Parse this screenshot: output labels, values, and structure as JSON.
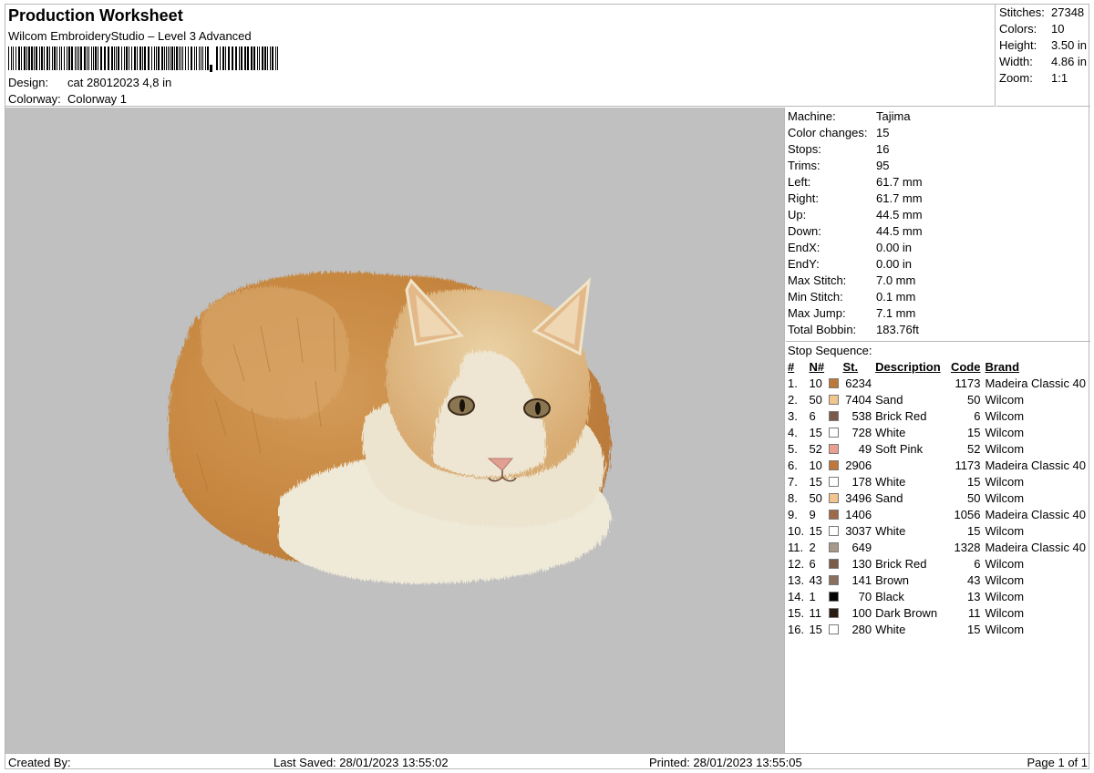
{
  "header": {
    "title": "Production Worksheet",
    "software": "Wilcom EmbroideryStudio – Level 3 Advanced",
    "design_label": "Design:",
    "design_value": "cat 28012023 4,8 in",
    "colorway_label": "Colorway:",
    "colorway_value": "Colorway 1"
  },
  "stats": [
    {
      "label": "Stitches:",
      "value": "27348"
    },
    {
      "label": "Colors:",
      "value": "10"
    },
    {
      "label": "Height:",
      "value": "3.50 in"
    },
    {
      "label": "Width:",
      "value": "4.86 in"
    },
    {
      "label": "Zoom:",
      "value": "1:1"
    }
  ],
  "machine_info": [
    {
      "label": "Machine:",
      "value": "Tajima"
    },
    {
      "label": "Color changes:",
      "value": "15"
    },
    {
      "label": "Stops:",
      "value": "16"
    },
    {
      "label": "Trims:",
      "value": "95"
    },
    {
      "label": "Left:",
      "value": "61.7 mm"
    },
    {
      "label": "Right:",
      "value": "61.7 mm"
    },
    {
      "label": "Up:",
      "value": "44.5 mm"
    },
    {
      "label": "Down:",
      "value": "44.5 mm"
    },
    {
      "label": "EndX:",
      "value": "0.00 in"
    },
    {
      "label": "EndY:",
      "value": "0.00 in"
    },
    {
      "label": "Max Stitch:",
      "value": "7.0 mm"
    },
    {
      "label": "Min Stitch:",
      "value": "0.1 mm"
    },
    {
      "label": "Max Jump:",
      "value": "7.1 mm"
    },
    {
      "label": "Total Bobbin:",
      "value": "183.76ft"
    }
  ],
  "stop_sequence": {
    "title": "Stop Sequence:",
    "columns": {
      "num": "#",
      "n": "N#",
      "st": "St.",
      "desc": "Description",
      "code": "Code",
      "brand": "Brand"
    },
    "rows": [
      {
        "num": "1.",
        "n": "10",
        "color": "#c0783a",
        "st": "6234",
        "desc": "",
        "code": "1173",
        "brand": "Madeira Classic 40"
      },
      {
        "num": "2.",
        "n": "50",
        "color": "#f2c48e",
        "st": "7404",
        "desc": "Sand",
        "code": "50",
        "brand": "Wilcom"
      },
      {
        "num": "3.",
        "n": "6",
        "color": "#7a5a48",
        "st": "538",
        "desc": "Brick Red",
        "code": "6",
        "brand": "Wilcom"
      },
      {
        "num": "4.",
        "n": "15",
        "color": "#ffffff",
        "st": "728",
        "desc": "White",
        "code": "15",
        "brand": "Wilcom"
      },
      {
        "num": "5.",
        "n": "52",
        "color": "#e8a090",
        "st": "49",
        "desc": "Soft Pink",
        "code": "52",
        "brand": "Wilcom"
      },
      {
        "num": "6.",
        "n": "10",
        "color": "#c0783a",
        "st": "2906",
        "desc": "",
        "code": "1173",
        "brand": "Madeira Classic 40"
      },
      {
        "num": "7.",
        "n": "15",
        "color": "#ffffff",
        "st": "178",
        "desc": "White",
        "code": "15",
        "brand": "Wilcom"
      },
      {
        "num": "8.",
        "n": "50",
        "color": "#f2c48e",
        "st": "3496",
        "desc": "Sand",
        "code": "50",
        "brand": "Wilcom"
      },
      {
        "num": "9.",
        "n": "9",
        "color": "#a06a48",
        "st": "1406",
        "desc": "",
        "code": "1056",
        "brand": "Madeira Classic 40"
      },
      {
        "num": "10.",
        "n": "15",
        "color": "#ffffff",
        "st": "3037",
        "desc": "White",
        "code": "15",
        "brand": "Wilcom"
      },
      {
        "num": "11.",
        "n": "2",
        "color": "#a89888",
        "st": "649",
        "desc": "",
        "code": "1328",
        "brand": "Madeira Classic 40"
      },
      {
        "num": "12.",
        "n": "6",
        "color": "#7a5a48",
        "st": "130",
        "desc": "Brick Red",
        "code": "6",
        "brand": "Wilcom"
      },
      {
        "num": "13.",
        "n": "43",
        "color": "#8a7060",
        "st": "141",
        "desc": "Brown",
        "code": "43",
        "brand": "Wilcom"
      },
      {
        "num": "14.",
        "n": "1",
        "color": "#000000",
        "st": "70",
        "desc": "Black",
        "code": "13",
        "brand": "Wilcom"
      },
      {
        "num": "15.",
        "n": "11",
        "color": "#2a1a10",
        "st": "100",
        "desc": "Dark Brown",
        "code": "11",
        "brand": "Wilcom"
      },
      {
        "num": "16.",
        "n": "15",
        "color": "#ffffff",
        "st": "280",
        "desc": "White",
        "code": "15",
        "brand": "Wilcom"
      }
    ]
  },
  "footer": {
    "created_by": "Created By:",
    "last_saved": "Last Saved: 28/01/2023 13:55:02",
    "printed": "Printed: 28/01/2023 13:55:05",
    "page": "Page 1 of 1"
  },
  "preview": {
    "background": "#c0c0c0",
    "colors": {
      "orange": "#c98a4a",
      "sand": "#e8c38e",
      "cream": "#f0ead8",
      "white": "#f4f1e8",
      "eye": "#8a7650",
      "nose": "#e2a094"
    }
  }
}
